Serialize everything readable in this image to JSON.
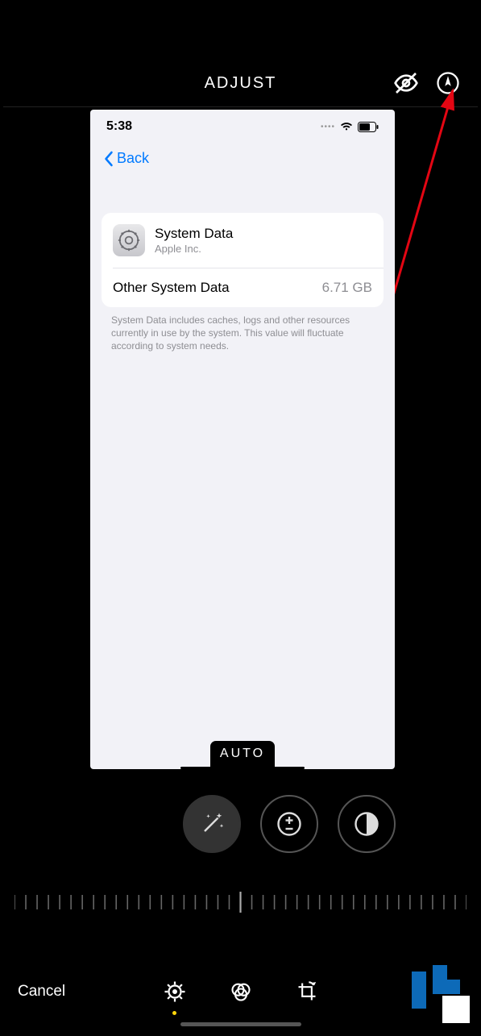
{
  "topbar": {
    "title": "ADJUST"
  },
  "preview": {
    "status_time": "5:38",
    "nav_back": "Back",
    "card": {
      "title": "System Data",
      "subtitle": "Apple Inc.",
      "row2_label": "Other System Data",
      "row2_value": "6.71 GB"
    },
    "footer": "System Data includes caches, logs and other resources currently in use by the system. This value will fluctuate according to system needs.",
    "auto_label": "AUTO"
  },
  "bottombar": {
    "cancel": "Cancel"
  },
  "icons": {
    "hide": "eye-off-icon",
    "markup": "markup-icon",
    "wand": "magic-wand-icon",
    "exposure": "exposure-icon",
    "contrast": "contrast-icon",
    "adjust": "adjust-dial-icon",
    "filters": "filters-icon",
    "crop": "crop-rotate-icon"
  }
}
